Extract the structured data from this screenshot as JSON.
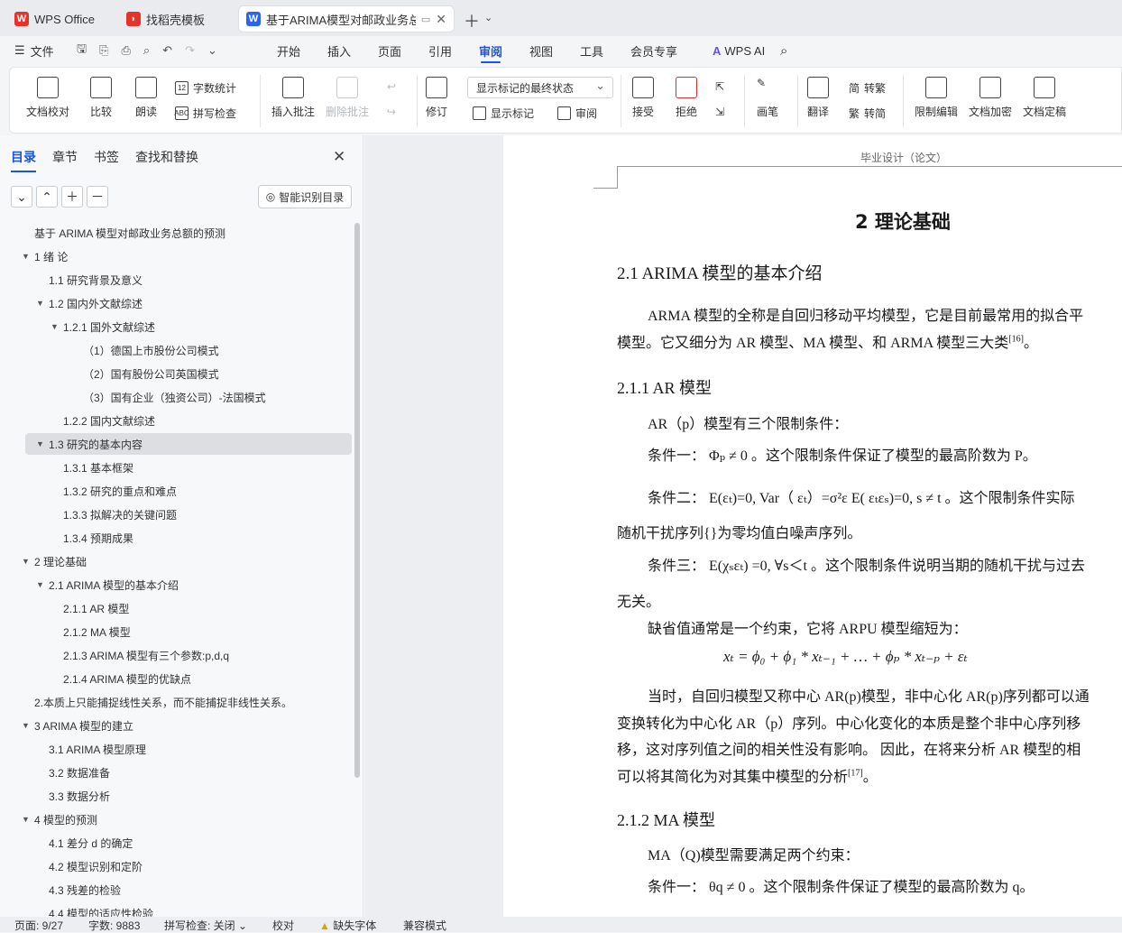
{
  "tabs": {
    "wps": "WPS Office",
    "template": "找稻壳模板",
    "doc": "基于ARIMA模型对邮政业务总"
  },
  "menu": {
    "file": "文件",
    "items": [
      "开始",
      "插入",
      "页面",
      "引用",
      "审阅",
      "视图",
      "工具",
      "会员专享"
    ],
    "ai": "WPS AI"
  },
  "ribbon": {
    "proofread": "文档校对",
    "compare": "比较",
    "read": "朗读",
    "wordcount": "字数统计",
    "spellcheck": "拼写检查",
    "insert_comment": "插入批注",
    "delete_comment": "删除批注",
    "track": "修订",
    "markup_mode": "显示标记的最终状态",
    "show_markup": "显示标记",
    "review": "审阅",
    "accept": "接受",
    "reject": "拒绝",
    "pen": "画笔",
    "translate": "翻译",
    "to_traditional": "转繁",
    "to_simplified": "转简",
    "restrict": "限制编辑",
    "encrypt": "文档加密",
    "finalize": "文档定稿"
  },
  "sidebar": {
    "tabs": [
      "目录",
      "章节",
      "书签",
      "查找和替换"
    ],
    "smart_toc": "智能识别目录",
    "toc": [
      {
        "text": "基于 ARIMA 模型对邮政业务总额的预测",
        "level": 0,
        "arrow": ""
      },
      {
        "text": "1  绪  论",
        "level": 0,
        "arrow": "▼"
      },
      {
        "text": "1.1  研究背景及意义",
        "level": 1,
        "arrow": ""
      },
      {
        "text": "1.2  国内外文献综述",
        "level": 1,
        "arrow": "▼"
      },
      {
        "text": "1.2.1  国外文献综述",
        "level": 2,
        "arrow": "▼"
      },
      {
        "text": "（1）德国上市股份公司模式",
        "level": 3,
        "arrow": ""
      },
      {
        "text": "（2）国有股份公司英国模式",
        "level": 3,
        "arrow": ""
      },
      {
        "text": "（3）国有企业（独资公司）-法国模式",
        "level": 3,
        "arrow": ""
      },
      {
        "text": "1.2.2  国内文献综述",
        "level": 2,
        "arrow": ""
      },
      {
        "text": "1.3  研究的基本内容",
        "level": 1,
        "arrow": "▼"
      },
      {
        "text": "1.3.1  基本框架",
        "level": 2,
        "arrow": ""
      },
      {
        "text": "1.3.2  研究的重点和难点",
        "level": 2,
        "arrow": ""
      },
      {
        "text": "1.3.3  拟解决的关键问题",
        "level": 2,
        "arrow": ""
      },
      {
        "text": "1.3.4  预期成果",
        "level": 2,
        "arrow": ""
      },
      {
        "text": "2  理论基础",
        "level": 0,
        "arrow": "▼"
      },
      {
        "text": "2.1    ARIMA 模型的基本介绍",
        "level": 1,
        "arrow": "▼"
      },
      {
        "text": "2.1.1    AR 模型",
        "level": 2,
        "arrow": ""
      },
      {
        "text": "2.1.2    MA 模型",
        "level": 2,
        "arrow": ""
      },
      {
        "text": "2.1.3 ARIMA 模型有三个参数:p,d,q",
        "level": 2,
        "arrow": ""
      },
      {
        "text": "2.1.4    ARIMA 模型的优缺点",
        "level": 2,
        "arrow": ""
      },
      {
        "text": "2.本质上只能捕捉线性关系，而不能捕捉非线性关系。",
        "level": 0,
        "arrow": ""
      },
      {
        "text": "3 ARIMA 模型的建立",
        "level": 0,
        "arrow": "▼"
      },
      {
        "text": "3.1 ARIMA 模型原理",
        "level": 1,
        "arrow": ""
      },
      {
        "text": "3.2  数据准备",
        "level": 1,
        "arrow": ""
      },
      {
        "text": "3.3  数据分析",
        "level": 1,
        "arrow": ""
      },
      {
        "text": "4  模型的预测",
        "level": 0,
        "arrow": "▼"
      },
      {
        "text": "4.1  差分 d 的确定",
        "level": 1,
        "arrow": ""
      },
      {
        "text": "4.2  模型识别和定阶",
        "level": 1,
        "arrow": ""
      },
      {
        "text": "4.3 残差的检验",
        "level": 1,
        "arrow": ""
      },
      {
        "text": "4.4  模型的适应性检验",
        "level": 1,
        "arrow": ""
      }
    ]
  },
  "doc": {
    "header": "毕业设计（论文）",
    "chapter": "2  理论基础",
    "s21": "2.1    ARIMA 模型的基本介绍",
    "p1a": "ARMA 模型的全称是自回归移动平均模型，它是目前最常用的拟合平",
    "p1b": "模型。它又细分为 AR 模型、MA 模型、和 ARMA 模型三大类",
    "ref16": "[16]",
    "p1end": "。",
    "s211": "2.1.1    AR 模型",
    "ar1": "AR（p）模型有三个限制条件：",
    "c1": "条件一：  Φₚ ≠ 0 。这个限制条件保证了模型的最高阶数为 P。",
    "c2": "条件二：  E(εₜ)=0,   Var（ εₜ）=σ²ε   E( εₜεₛ)=0,    s ≠ t 。这个限制条件实际",
    "c2b": "随机干扰序列{}为零均值白噪声序列。",
    "c3": "条件三：  E(χₛεₜ)  =0, ∀s＜t 。这个限制条件说明当期的随机干扰与过去",
    "c3b": "无关。",
    "def": "缺省值通常是一个约束，它将 ARPU 模型缩短为：",
    "formula": "xₜ  =  ϕ₀  +  ϕ₁ * xₜ₋₁ + … + ϕₚ * xₜ₋ₚ + εₜ",
    "p2a": "当时，自回归模型又称中心 AR(p)模型，非中心化 AR(p)序列都可以通",
    "p2b": "变换转化为中心化 AR（p）序列。中心化变化的本质是整个非中心序列移",
    "p2c": "移，这对序列值之间的相关性没有影响。  因此，在将来分析 AR 模型的相",
    "p2d": "可以将其简化为对其集中模型的分析",
    "ref17": "[17]",
    "p2end": "。",
    "s212": "2.1.2    MA 模型",
    "ma1": "MA（Q)模型需要满足两个约束：",
    "mc1": "条件一：  θq ≠ 0 。这个限制条件保证了模型的最高阶数为 q。"
  },
  "status": {
    "page": "页面: 9/27",
    "words": "字数: 9883",
    "spell": "拼写检查: 关闭",
    "proof": "校对",
    "missing_font": "缺失字体",
    "compat": "兼容模式"
  }
}
